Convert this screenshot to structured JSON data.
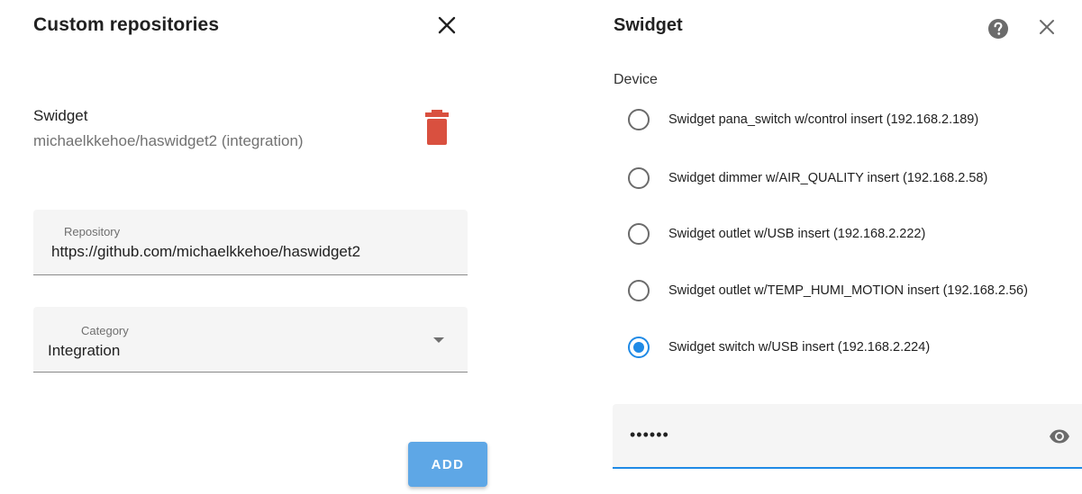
{
  "left_dialog": {
    "title": "Custom repositories",
    "repository_item": {
      "name": "Swidget",
      "path": "michaelkkehoe/haswidget2 (integration)"
    },
    "repository_field": {
      "label": "Repository",
      "value": "https://github.com/michaelkkehoe/haswidget2"
    },
    "category_field": {
      "label": "Category",
      "value": "Integration"
    },
    "add_label": "ADD",
    "icons": {
      "close": "close-icon",
      "delete": "trash-icon",
      "dropdown": "chevron-down-icon"
    },
    "colors": {
      "delete": "#d9503f",
      "add_button": "#5ea7e6"
    }
  },
  "right_dialog": {
    "title": "Swidget",
    "device_label": "Device",
    "devices": [
      {
        "label": "Swidget pana_switch w/control insert (192.168.2.189)",
        "selected": false
      },
      {
        "label": "Swidget dimmer w/AIR_QUALITY insert (192.168.2.58)",
        "selected": false
      },
      {
        "label": "Swidget outlet w/USB insert (192.168.2.222)",
        "selected": false
      },
      {
        "label": "Swidget outlet w/TEMP_HUMI_MOTION insert (192.168.2.56)",
        "selected": false
      },
      {
        "label": "Swidget switch w/USB insert (192.168.2.224)",
        "selected": true
      }
    ],
    "password_field": {
      "value": "••••••"
    },
    "icons": {
      "help": "help-icon",
      "close": "close-icon",
      "visibility": "eye-icon"
    },
    "colors": {
      "accent": "#1f8ae6"
    }
  }
}
